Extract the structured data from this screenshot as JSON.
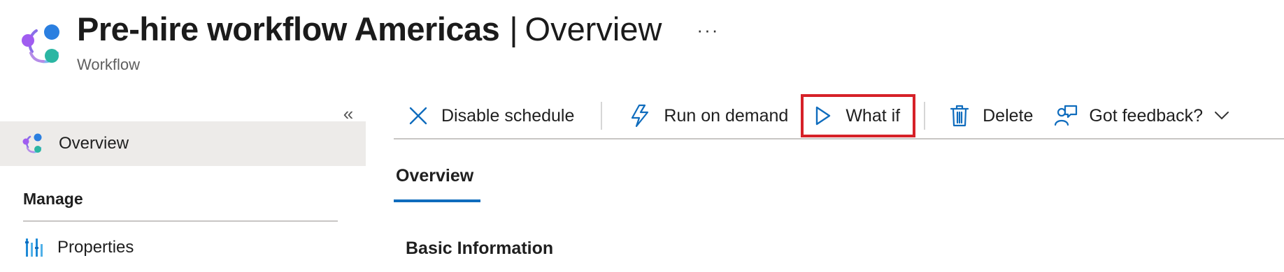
{
  "header": {
    "title": "Pre-hire workflow Americas",
    "separator": "|",
    "section": "Overview",
    "more": "···",
    "subtitle": "Workflow",
    "icon": "lifecycle-workflow-icon"
  },
  "sidebar": {
    "collapse_glyph": "«",
    "items": [
      {
        "label": "Overview",
        "icon": "lifecycle-workflow-icon",
        "selected": true
      }
    ],
    "manage_heading": "Manage",
    "manage_items": [
      {
        "label": "Properties",
        "icon": "properties-icon"
      }
    ]
  },
  "toolbar": {
    "buttons": [
      {
        "label": "Disable schedule",
        "icon": "close-icon"
      },
      {
        "label": "Run on demand",
        "icon": "lightning-icon"
      },
      {
        "label": "What if",
        "icon": "play-icon",
        "highlighted": true
      },
      {
        "label": "Delete",
        "icon": "trash-icon"
      },
      {
        "label": "Got feedback?",
        "icon": "feedback-icon",
        "dropdown": true
      }
    ]
  },
  "main": {
    "tabs": [
      {
        "label": "Overview",
        "active": true
      }
    ],
    "section_heading": "Basic Information"
  },
  "colors": {
    "accent": "#0f6cbd",
    "highlight_border": "#d62128",
    "selected_nav_bg": "#edebe9",
    "icon_blue": "#0f6cbd"
  }
}
